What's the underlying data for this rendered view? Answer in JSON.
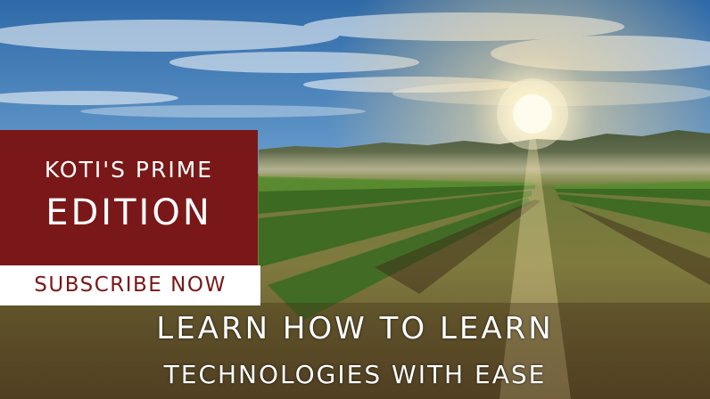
{
  "brand": {
    "line1": "KOTI'S PRIME",
    "line2": "EDITION"
  },
  "cta": {
    "label": "SUBSCRIBE NOW"
  },
  "headline": {
    "line1": "LEARN HOW TO LEARN",
    "line2": "TECHNOLOGIES WITH EASE"
  },
  "colors": {
    "brand_box": "#7a1718",
    "cta_background": "#ffffff",
    "cta_text": "#7a1718",
    "headline_text": "#ffffff"
  }
}
